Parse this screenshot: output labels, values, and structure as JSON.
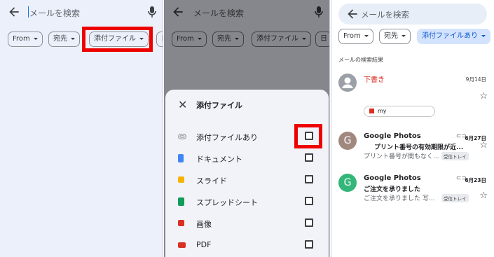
{
  "search": {
    "placeholder": "メールを検索"
  },
  "chips": {
    "from": "From",
    "to": "宛先",
    "attachment": "添付ファイル",
    "date_partial": "日",
    "attachment_active": "添付ファイルあり"
  },
  "sheet": {
    "title": "添付ファイル",
    "options": [
      {
        "label": "添付ファイルあり",
        "icon": "paperclip-icon",
        "color": "#9aa0a6"
      },
      {
        "label": "ドキュメント",
        "icon": "docs-icon",
        "color": "#4285f4"
      },
      {
        "label": "スライド",
        "icon": "slides-icon",
        "color": "#f4b400"
      },
      {
        "label": "スプレッドシート",
        "icon": "sheets-icon",
        "color": "#0f9d58"
      },
      {
        "label": "画像",
        "icon": "image-icon",
        "color": "#d93025"
      },
      {
        "label": "PDF",
        "icon": "pdf-icon",
        "color": "#d93025"
      }
    ]
  },
  "results": {
    "heading": "メールの検索結果",
    "mails": [
      {
        "sender": "下書き",
        "date": "9月14日",
        "attachment": "my",
        "avatar_color": "#9aa0a6"
      },
      {
        "sender": "Google Photos",
        "date": "6月27日",
        "subject": "プリント番号の有効期限が近...",
        "snippet": "プリント番号が間もなく...",
        "label": "受信トレイ",
        "avatar_letter": "G",
        "avatar_color": "#a1887f"
      },
      {
        "sender": "Google Photos",
        "date": "6月23日",
        "subject": "ご注文を承りました",
        "snippet": "ご注文を承りました 写...",
        "label": "受信トレイ",
        "avatar_letter": "G",
        "avatar_color": "#33b679"
      }
    ]
  },
  "colors": {
    "highlight": "#ee0000",
    "active_chip": "#d3e3fd",
    "draft_red": "#d93025"
  }
}
